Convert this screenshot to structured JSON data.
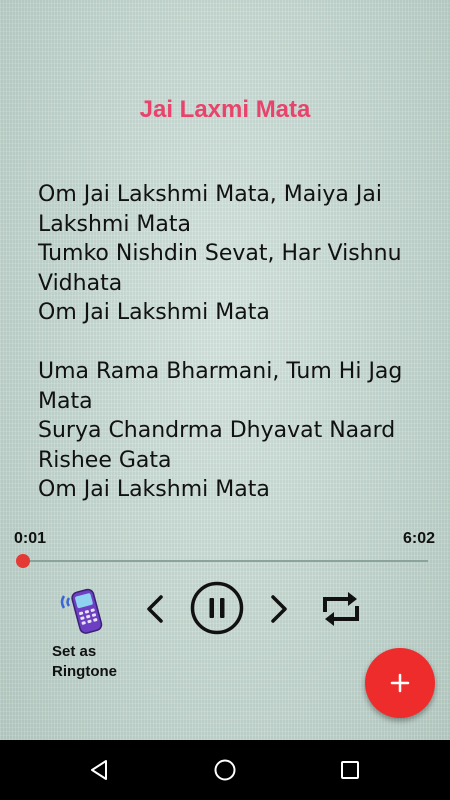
{
  "song": {
    "title": "Jai Laxmi Mata",
    "stanzas": [
      [
        "Om Jai Lakshmi Mata, Maiya Jai",
        "Lakshmi Mata",
        "Tumko Nishdin Sevat, Har Vishnu",
        "Vidhata",
        "Om Jai Lakshmi Mata"
      ],
      [
        "Uma Rama Bharmani, Tum Hi Jag",
        "Mata",
        "Surya Chandrma Dhyavat Naard",
        "Rishee Gata",
        "Om Jai Lakshmi Mata"
      ]
    ]
  },
  "player": {
    "current_time": "0:01",
    "duration": "6:02",
    "progress": 0.003,
    "accent_color": "#e53935"
  },
  "ringtone": {
    "label_line1": "Set as",
    "label_line2": "Ringtone",
    "icon": "ringing-phone-icon"
  },
  "controls": {
    "prev_icon": "chevron-left-icon",
    "play_icon": "pause-icon",
    "next_icon": "chevron-right-icon",
    "repeat_icon": "repeat-icon"
  },
  "fab": {
    "icon": "plus-icon",
    "color": "#ef2c2c"
  },
  "navbar": {
    "back_icon": "back-triangle-icon",
    "home_icon": "home-circle-icon",
    "recents_icon": "recents-square-icon"
  }
}
